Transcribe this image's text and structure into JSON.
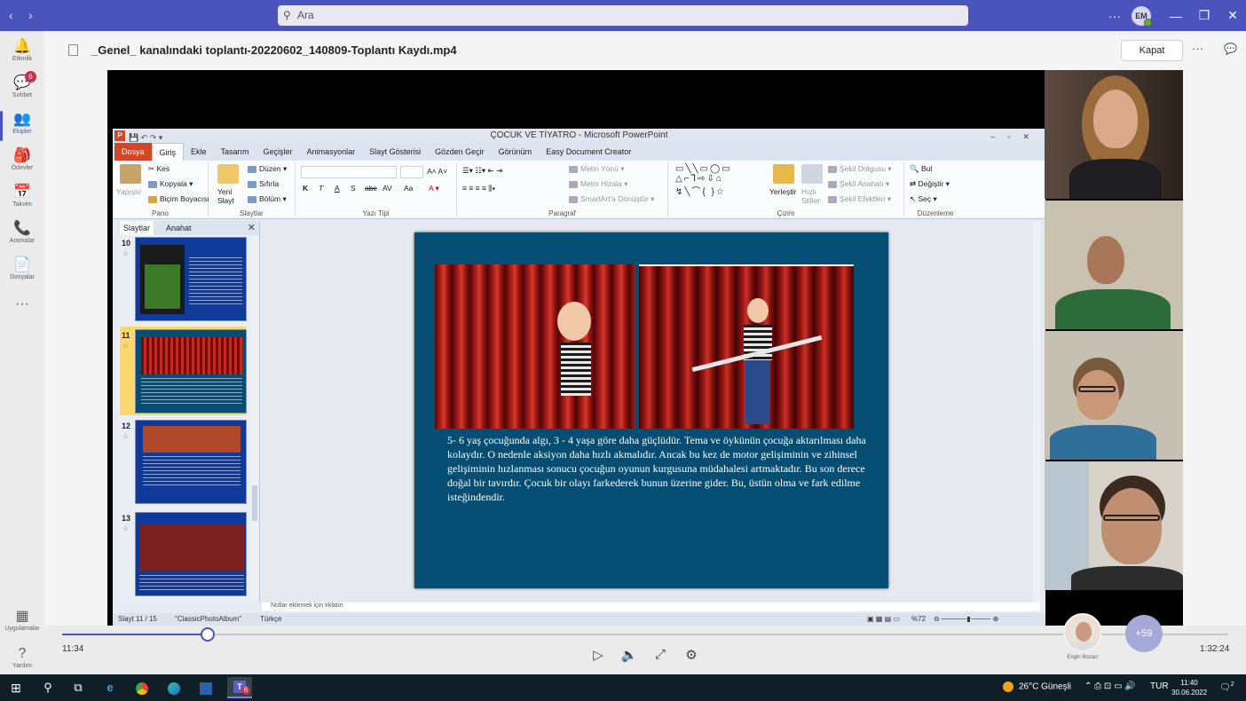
{
  "titlebar": {
    "back": "‹",
    "forward": "›",
    "search_placeholder": "Ara",
    "more": "···",
    "avatar_initials": "EM",
    "minimize": "—",
    "maximize": "❐",
    "close": "✕"
  },
  "rail": {
    "items": [
      {
        "label": "Etkinlik",
        "icon": "bell-icon",
        "glyph": "🔔"
      },
      {
        "label": "Sohbet",
        "icon": "chat-icon",
        "glyph": "💬",
        "badge": "6"
      },
      {
        "label": "Ekipler",
        "icon": "teams-icon",
        "glyph": "👥",
        "active": true
      },
      {
        "label": "Ödevler",
        "icon": "backpack-icon",
        "glyph": "🎒"
      },
      {
        "label": "Takvim",
        "icon": "calendar-icon",
        "glyph": "📅"
      },
      {
        "label": "Aramalar",
        "icon": "phone-icon",
        "glyph": "📞"
      },
      {
        "label": "Dosyalar",
        "icon": "file-icon",
        "glyph": "📄"
      },
      {
        "label": "",
        "icon": "more-icon",
        "glyph": "···"
      },
      {
        "label": "Uygulamalar",
        "icon": "apps-icon",
        "glyph": "▦"
      },
      {
        "label": "Yardım",
        "icon": "help-icon",
        "glyph": "?"
      }
    ]
  },
  "header": {
    "file_title": "_Genel_ kanalındaki toplantı-20220602_140809-Toplantı Kaydı.mp4",
    "close_label": "Kapat",
    "more": "···"
  },
  "ppt": {
    "window_title": "ÇOCUK VE TİYATRO  -  Microsoft PowerPoint",
    "logo": "P",
    "tabs": [
      "Dosya",
      "Giriş",
      "Ekle",
      "Tasarım",
      "Geçişler",
      "Animasyonlar",
      "Slayt Gösterisi",
      "Gözden Geçir",
      "Görünüm",
      "Easy Document Creator"
    ],
    "selected_tab": "Giriş",
    "ribbon": {
      "clipboard": {
        "paste": "Yapıştır",
        "cut": "Kes",
        "copy": "Kopyala",
        "format_painter": "Biçim Boyacısı",
        "name": "Pano"
      },
      "slides": {
        "new_slide": "Yeni Slayt",
        "layout": "Düzen",
        "reset": "Sıfırla",
        "section": "Bölüm",
        "name": "Slaytlar"
      },
      "font": {
        "name": "Yazı Tipi",
        "bold": "K",
        "italic": "T",
        "underline": "A",
        "shadow": "S",
        "strike": "abc",
        "spacing": "AV",
        "case": "Aa"
      },
      "paragraph": {
        "text_direction": "Metin Yönü",
        "align_text": "Metni Hizala",
        "smartart": "SmartArt'a Dönüştür",
        "name": "Paragraf"
      },
      "drawing": {
        "arrange": "Yerleştir",
        "quick_styles": "Hızlı Stiller",
        "fill": "Şekil Dolgusu",
        "outline": "Şekil Anahatı",
        "effects": "Şekil Efektleri",
        "name": "Çizim"
      },
      "editing": {
        "find": "Bul",
        "replace": "Değiştir",
        "select": "Seç",
        "name": "Düzenleme"
      }
    },
    "pane_tabs": [
      "Slaytlar",
      "Anahat"
    ],
    "thumbs": [
      {
        "num": "10",
        "selected": false
      },
      {
        "num": "11",
        "selected": true
      },
      {
        "num": "12",
        "selected": false
      },
      {
        "num": "13",
        "selected": false
      }
    ],
    "slide_text": "5- 6 yaş çocuğunda algı, 3 - 4 yaşa göre daha güçlüdür. Tema ve öykünün çocuğa aktarılması daha kolaydır. O nedenle aksiyon daha hızlı akmalıdır. Ancak bu kez de motor gelişiminin ve zihinsel gelişiminin hızlanması sonucu çocuğun oyunun kurgusuna müdahalesi artmaktadır. Bu son derece doğal bir tavırdır. Çocuk bir olayı farkederek bunun üzerine gider. Bu, üstün olma ve fark edilme isteğindendir.",
    "notes": "Notlar eklemek için tıklatın",
    "status": {
      "slide": "Slayt 11 / 15",
      "theme": "\"ClassicPhotoAlbum\"",
      "language": "Türkçe",
      "zoom": "%72"
    }
  },
  "player": {
    "elapsed": "11:34",
    "total": "1:32:24",
    "progress_fraction": 0.125,
    "participant_name": "Engin Bozacı",
    "more_participants": "+59"
  },
  "taskbar": {
    "weather": "26°C  Güneşli",
    "language": "TUR",
    "time": "11:40",
    "date": "30.06.2022",
    "notifications": "2",
    "teams_badge": "6"
  },
  "colors": {
    "teams_purple": "#4b53bc",
    "slide_bg": "#054d72",
    "ppt_orange": "#d24726"
  }
}
